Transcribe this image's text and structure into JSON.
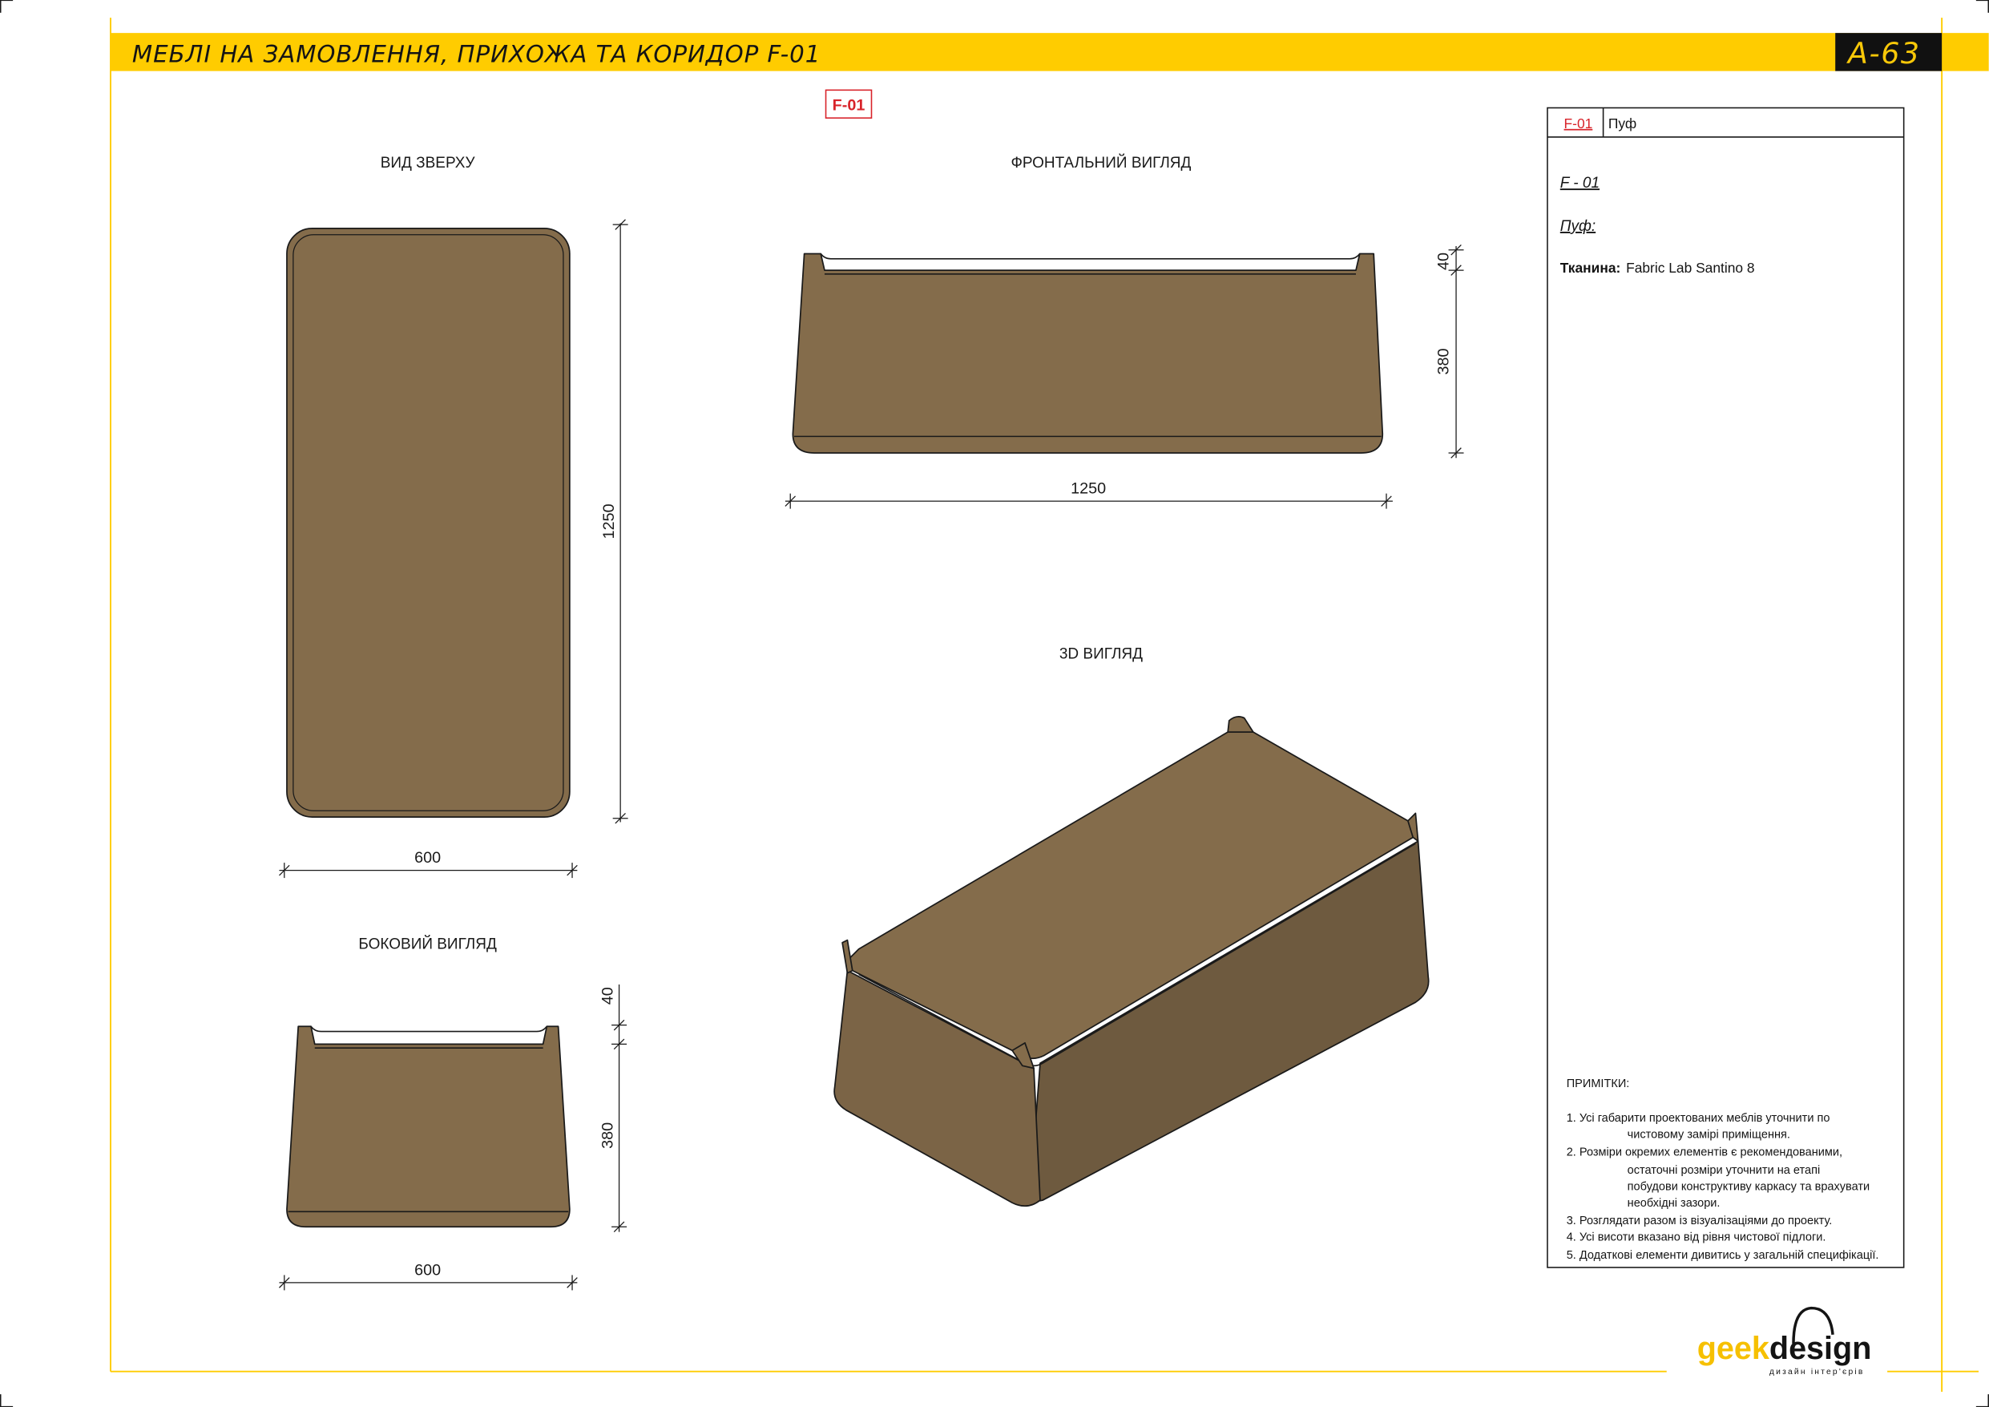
{
  "header": {
    "title": "МЕБЛІ НА ЗАМОВЛЕННЯ, ПРИХОЖА ТА КОРИДОР F-01",
    "sheet_number": "A-63"
  },
  "item_tag": "F-01",
  "views": {
    "top": {
      "caption": "ВИД ЗВЕРХУ",
      "dim_length": "1250",
      "dim_width": "600"
    },
    "front": {
      "caption": "ФРОНТАЛЬНИЙ ВИГЛЯД",
      "dim_length": "1250",
      "dim_cushion": "40",
      "dim_body": "380"
    },
    "side": {
      "caption": "БОКОВИЙ ВИГЛЯД",
      "dim_width": "600",
      "dim_cushion": "40",
      "dim_body": "380"
    },
    "iso": {
      "caption": "3D ВИГЛЯД"
    }
  },
  "spec": {
    "code": "F-01",
    "name": "Пуф",
    "heading_code": "F - 01",
    "heading_name": "Пуф:",
    "fabric_label": "Тканина:",
    "fabric_value": "Fabric Lab Santino 8",
    "notes_title": "ПРИМІТКИ:",
    "notes": [
      [
        "1. Усі габарити проектованих меблів уточнити по",
        "чистовому замірі приміщення."
      ],
      [
        "2. Розміри окремих елементів є рекомендованими,",
        "остаточні розміри уточнити на етапі",
        "побудови конструктиву каркасу та врахувати",
        "необхідні зазори."
      ],
      [
        "3. Розглядати разом із візуалізаціями до проекту."
      ],
      [
        "4. Усі висоти вказано від рівня чистової підлоги."
      ],
      [
        "5. Додаткові елементи дивитись у загальній специфікації."
      ]
    ]
  },
  "logo": {
    "part1": "geek",
    "part2": "design",
    "subtitle": "дизайн інтер'єрів"
  },
  "colors": {
    "accent_yellow": "#ffcc00",
    "furniture_brown": "#846c4b",
    "tag_red": "#d8232a"
  }
}
